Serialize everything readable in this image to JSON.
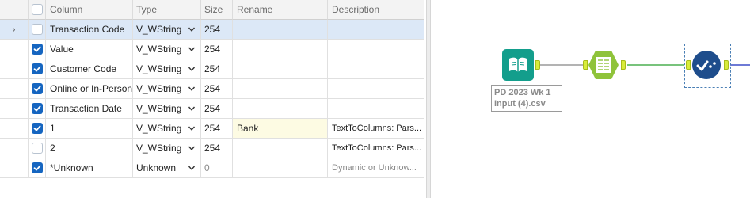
{
  "grid": {
    "headers": {
      "column": "Column",
      "type": "Type",
      "size": "Size",
      "rename": "Rename",
      "description": "Description"
    },
    "rows": [
      {
        "column": "Transaction Code",
        "type": "V_WString",
        "size": "254",
        "rename": "",
        "description": "",
        "checked": false,
        "selected": true,
        "expander": "›"
      },
      {
        "column": "Value",
        "type": "V_WString",
        "size": "254",
        "rename": "",
        "description": "",
        "checked": true
      },
      {
        "column": "Customer Code",
        "type": "V_WString",
        "size": "254",
        "rename": "",
        "description": "",
        "checked": true
      },
      {
        "column": "Online or In-Person",
        "type": "V_WString",
        "size": "254",
        "rename": "",
        "description": "",
        "checked": true
      },
      {
        "column": "Transaction Date",
        "type": "V_WString",
        "size": "254",
        "rename": "",
        "description": "",
        "checked": true
      },
      {
        "column": "1",
        "type": "V_WString",
        "size": "254",
        "rename": "Bank",
        "description": "TextToColumns: Pars...",
        "checked": true
      },
      {
        "column": "2",
        "type": "V_WString",
        "size": "254",
        "rename": "",
        "description": "TextToColumns: Pars...",
        "checked": false
      },
      {
        "column": "*Unknown",
        "type": "Unknown",
        "size": "0",
        "rename": "",
        "description": "Dynamic or Unknow...",
        "checked": true,
        "muted": true
      }
    ]
  },
  "canvas": {
    "input_tool": {
      "label_line1": "PD 2023 Wk 1",
      "label_line2": "Input (4).csv",
      "icon": "book-icon",
      "color": "#139e8c"
    },
    "text_to_columns_tool": {
      "icon": "text-to-columns-icon",
      "color": "#8fc33a"
    },
    "select_tool": {
      "icon": "select-check-icon",
      "color": "#1e4d8c"
    }
  },
  "colors": {
    "checkbox_on": "#1565c0",
    "row_selected": "#dce8f7",
    "rename_highlight": "#fdfbe3"
  }
}
